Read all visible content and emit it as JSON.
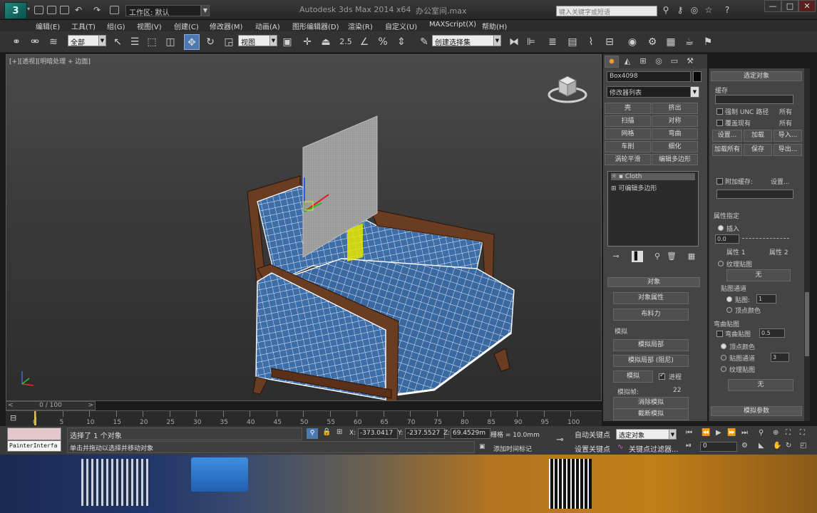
{
  "titlebar": {
    "logo_text": "3",
    "workspace_label": "工作区: 默认",
    "app_title": "Autodesk 3ds Max  2014 x64",
    "file_title": "办公室间.max",
    "search_placeholder": "键入关键字或短语",
    "window_min": "—",
    "window_max": "□",
    "window_close": "✕"
  },
  "menubar": {
    "items": [
      "编辑(E)",
      "工具(T)",
      "组(G)",
      "视图(V)",
      "创建(C)",
      "修改器(M)",
      "动画(A)",
      "图形编辑器(D)",
      "渲染(R)",
      "自定义(U)",
      "MAXScript(X)",
      "帮助(H)"
    ]
  },
  "toolbar": {
    "filter_value": "全部",
    "refcoord_value": "视图",
    "spinner_snap_label": "2.5",
    "named_sel_placeholder": "创建选择集"
  },
  "viewport": {
    "label": "[+][透视][明暗处理 + 边面]"
  },
  "cmdpanel": {
    "object_name": "Box4098",
    "modifier_list": "修改器列表",
    "buttons": [
      "壳",
      "挤出",
      "扫描",
      "对称",
      "网格",
      "弯曲",
      "车削",
      "细化",
      "涡轮平滑",
      "编辑多边形"
    ],
    "stack": [
      "Cloth",
      "可编辑多边形"
    ],
    "object_rollout": "对象",
    "object_props": "对象属性",
    "cloth_force": "布料力",
    "sim_group": "模拟",
    "sim_local": "模拟局部",
    "sim_local_damped": "模拟局部 (阻尼)",
    "simulate": "模拟",
    "progress_label": "进程",
    "frames_label": "模拟帧:",
    "frames_value": "22",
    "erase_sim": "消除模拟",
    "truncate_sim": "截断模拟"
  },
  "rightpanel": {
    "title": "选定对象",
    "cache": "缓存",
    "force_unc": "强制 UNC 路径",
    "all1": "所有",
    "overwrite": "覆盖现有",
    "all2": "所有",
    "settings": "设置...",
    "load": "加载",
    "import": "导入...",
    "load_all": "加载所有",
    "save": "保存",
    "export": "导出...",
    "append_cache": "附加缓存:",
    "settings2": "设置...",
    "property_assign": "属性指定",
    "insert": "插入",
    "insert_value": "0.0",
    "prop1": "属性 1",
    "prop2": "属性 2",
    "tex_map": "纹理贴图",
    "none1": "无",
    "map_channel_group": "贴图通道",
    "map_channel": "贴图:",
    "map_channel_value": "1",
    "vertex_color": "顶点颜色",
    "bend_map": "弯曲贴图",
    "bend_map_label": "弯曲贴图",
    "bend_value": "0.5",
    "vertex_color2": "顶点颜色",
    "map_channel2": "贴图通道",
    "map_channel2_value": "3",
    "tex_map2": "纹理贴图",
    "none2": "无",
    "sim_params": "模拟参数"
  },
  "timeline": {
    "frame_counter": "0 / 100",
    "ticks": [
      "0",
      "5",
      "10",
      "15",
      "20",
      "25",
      "30",
      "35",
      "40",
      "45",
      "50",
      "55",
      "60",
      "65",
      "70",
      "75",
      "80",
      "85",
      "90",
      "95",
      "100"
    ]
  },
  "status": {
    "listener_text": "PainterInterfa",
    "prompt_selected": "选择了 1 个对象",
    "prompt_help": "单击并拖动以选择并移动对象",
    "x_label": "X:",
    "x_value": "-373.0417",
    "y_label": "Y:",
    "y_value": "-237.5527",
    "z_label": "Z:",
    "z_value": "69.4529m",
    "grid": "栅格 = 10.0mm",
    "add_time_tag": "添加时间标记",
    "auto_key": "自动关键点",
    "selection_set": "选定对象",
    "set_key": "设置关键点",
    "key_filters": "关键点过滤器...",
    "frame_value": "0"
  },
  "colors": {
    "accent_blue": "#4d79b3",
    "cloth_blue": "#3d6ea8",
    "wood": "#6a3c22",
    "gizmo_yellow": "#e8e800"
  }
}
